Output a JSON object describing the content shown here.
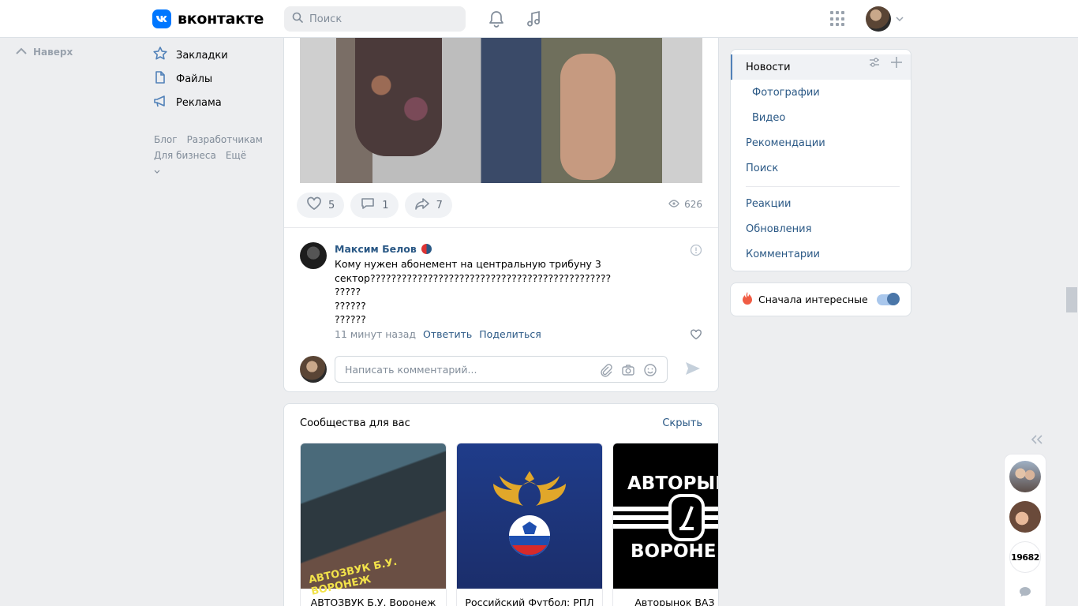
{
  "header": {
    "logo_mark": "vk",
    "logo_text": "вконтакте",
    "search_placeholder": "Поиск",
    "icons": [
      "search-icon",
      "bell-icon",
      "music-icon",
      "apps-grid-icon",
      "chevron-down-icon"
    ]
  },
  "left": {
    "up_label": "Наверх",
    "nav": [
      {
        "label": "Закладки",
        "icon": "star-icon"
      },
      {
        "label": "Файлы",
        "icon": "file-icon"
      },
      {
        "label": "Реклама",
        "icon": "megaphone-icon"
      }
    ],
    "footer": [
      "Блог",
      "Разработчикам",
      "Для бизнеса",
      "Ещё"
    ]
  },
  "post": {
    "likes": "5",
    "comments": "1",
    "shares": "7",
    "views": "626"
  },
  "comment": {
    "author": "Максим Белов",
    "text": "Кому нужен абонемент на центральную трибуну 3 сектор??????????????????????????????????????????????\n?????\n??????\n??????",
    "time": "11 минут назад",
    "reply": "Ответить",
    "share": "Поделиться"
  },
  "composer": {
    "placeholder": "Написать комментарий..."
  },
  "communities": {
    "title": "Сообщества для вас",
    "hide": "Скрыть",
    "items": [
      {
        "name": "АВТОЗВУК Б.У. Воронеж",
        "overlay": "АВТОЗВУК Б.У. ВОРОНЕЖ"
      },
      {
        "name": "Российский Футбол: РПЛ"
      },
      {
        "name": "Авторынок ВАЗ Вор",
        "overlay_top": "АВТОРЫН",
        "overlay_bottom": "ВОРОНЕ"
      }
    ]
  },
  "right_menu": {
    "items": [
      {
        "label": "Новости",
        "active": true
      },
      {
        "label": "Фотографии",
        "sub": true
      },
      {
        "label": "Видео",
        "sub": true
      },
      {
        "label": "Рекомендации"
      },
      {
        "label": "Поиск"
      },
      {
        "label": "Реакции"
      },
      {
        "label": "Обновления"
      },
      {
        "label": "Комментарии"
      }
    ]
  },
  "interesting": {
    "label": "Сначала интересные",
    "enabled": true
  },
  "dock": {
    "badge": "19682"
  },
  "colors": {
    "accent": "#0077ff",
    "link": "#2a5885",
    "muted": "#818c99",
    "background": "#edeef0"
  }
}
